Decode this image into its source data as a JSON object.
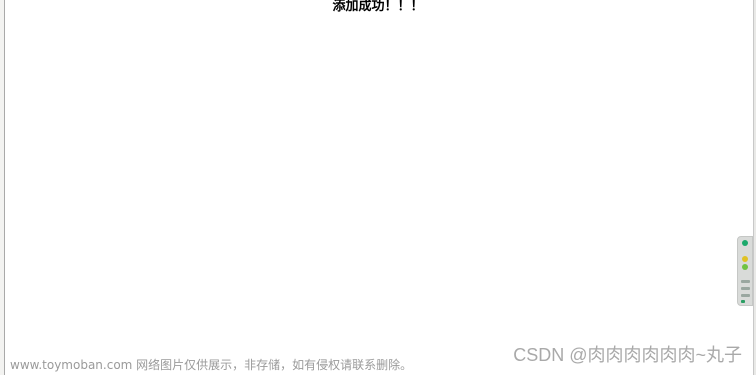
{
  "message": "添加成功！！！",
  "watermarks": {
    "left": "www.toymoban.com 网络图片仅供展示，非存储，如有侵权请联系删除。",
    "right": "CSDN @肉肉肉肉肉肉~丸子"
  },
  "side_widget": {
    "indicators": [
      "green",
      "yellow",
      "green"
    ]
  }
}
